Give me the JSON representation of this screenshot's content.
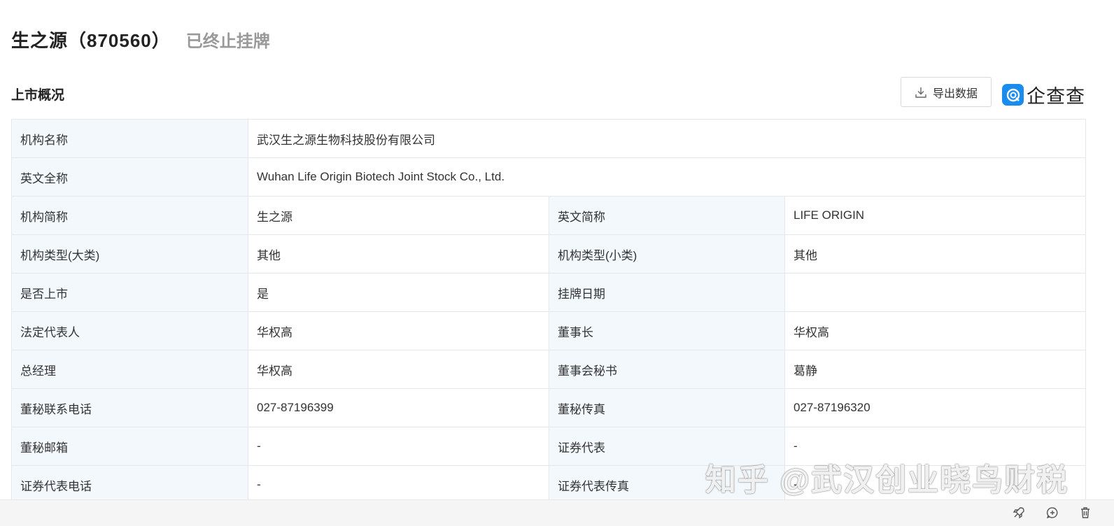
{
  "header": {
    "company_title": "生之源（870560）",
    "status": "已终止挂牌"
  },
  "section": {
    "title": "上市概况"
  },
  "toolbar": {
    "export_label": "导出数据",
    "brand_name": "企查查",
    "brand_color": "#1a8cf0"
  },
  "table": {
    "org_name": {
      "label": "机构名称",
      "value": "武汉生之源生物科技股份有限公司"
    },
    "en_full": {
      "label": "英文全称",
      "value": "Wuhan Life Origin Biotech Joint Stock Co., Ltd."
    },
    "rows": [
      [
        {
          "label": "机构简称",
          "value": "生之源"
        },
        {
          "label": "英文简称",
          "value": "LIFE ORIGIN"
        }
      ],
      [
        {
          "label": "机构类型(大类)",
          "value": "其他"
        },
        {
          "label": "机构类型(小类)",
          "value": "其他"
        }
      ],
      [
        {
          "label": "是否上市",
          "value": "是"
        },
        {
          "label": "挂牌日期",
          "value": ""
        }
      ],
      [
        {
          "label": "法定代表人",
          "value": "华权高"
        },
        {
          "label": "董事长",
          "value": "华权高"
        }
      ],
      [
        {
          "label": "总经理",
          "value": "华权高"
        },
        {
          "label": "董事会秘书",
          "value": "葛静"
        }
      ],
      [
        {
          "label": "董秘联系电话",
          "value": "027-87196399"
        },
        {
          "label": "董秘传真",
          "value": "027-87196320"
        }
      ],
      [
        {
          "label": "董秘邮箱",
          "value": "-"
        },
        {
          "label": "证券代表",
          "value": "-"
        }
      ],
      [
        {
          "label": "证券代表电话",
          "value": "-"
        },
        {
          "label": "证券代表传真",
          "value": "-"
        }
      ]
    ]
  },
  "watermark": "知乎 @武汉创业晓鸟财税",
  "bottom_icons": [
    "rocket-icon",
    "add-comment-icon",
    "trash-icon"
  ]
}
